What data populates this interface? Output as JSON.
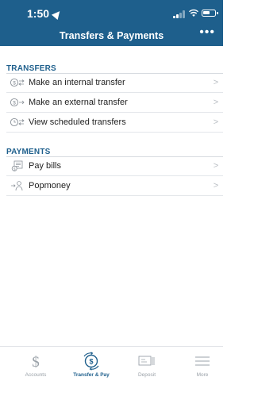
{
  "status_bar": {
    "time": "1:50"
  },
  "header": {
    "title": "Transfers & Payments"
  },
  "sections": {
    "transfers": {
      "header": "TRANSFERS",
      "items": [
        {
          "label": "Make an internal transfer",
          "icon": "internal-transfer-icon"
        },
        {
          "label": "Make an external transfer",
          "icon": "external-transfer-icon"
        },
        {
          "label": "View scheduled transfers",
          "icon": "scheduled-transfer-icon"
        }
      ]
    },
    "payments": {
      "header": "PAYMENTS",
      "items": [
        {
          "label": "Pay bills",
          "icon": "bill-icon"
        },
        {
          "label": "Popmoney",
          "icon": "popmoney-icon"
        }
      ]
    }
  },
  "tabs": [
    {
      "label": "Accounts",
      "icon": "dollar-icon",
      "active": false
    },
    {
      "label": "Transfer & Pay",
      "icon": "transfer-pay-icon",
      "active": true
    },
    {
      "label": "Deposit",
      "icon": "check-deposit-icon",
      "active": false
    },
    {
      "label": "More",
      "icon": "menu-icon",
      "active": false
    }
  ],
  "colors": {
    "brand": "#1e5f8c",
    "chevron": "#b8bdc3",
    "muted": "#9aa1a8"
  }
}
